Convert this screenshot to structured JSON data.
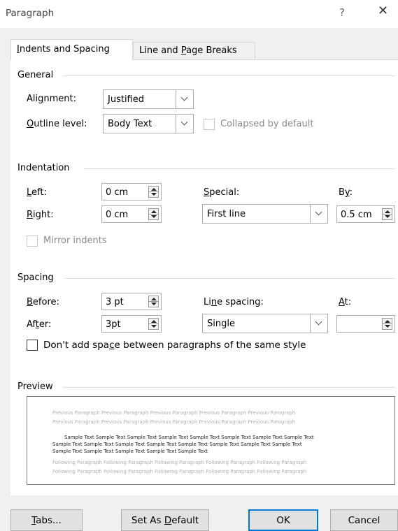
{
  "window": {
    "title": "Paragraph",
    "help": "?",
    "close": "✕"
  },
  "tabs": {
    "indents": {
      "before": "",
      "mnemonic": "I",
      "after": "ndents and Spacing"
    },
    "linebreaks": {
      "before": "Line and ",
      "mnemonic": "P",
      "after": "age Breaks"
    }
  },
  "general": {
    "heading": "General",
    "alignment": {
      "before": "Ali",
      "mnemonic": "g",
      "after": "nment:",
      "value": "Justified"
    },
    "outline": {
      "before": "",
      "mnemonic": "O",
      "after": "utline level:",
      "value": "Body Text"
    },
    "collapsed_label": "Collapsed by default"
  },
  "indentation": {
    "heading": "Indentation",
    "left": {
      "before": "",
      "mnemonic": "L",
      "after": "eft:",
      "value": "0 cm"
    },
    "right": {
      "before": "",
      "mnemonic": "R",
      "after": "ight:",
      "value": "0 cm"
    },
    "special": {
      "before": "",
      "mnemonic": "S",
      "after": "pecial:",
      "value": "First line"
    },
    "by": {
      "before": "B",
      "mnemonic": "y",
      "after": ":",
      "value": "0.5 cm"
    },
    "mirror_label": "Mirror indents"
  },
  "spacing": {
    "heading": "Spacing",
    "before": {
      "before": "",
      "mnemonic": "B",
      "after": "efore:",
      "value": "3 pt"
    },
    "after": {
      "before": "Af",
      "mnemonic": "t",
      "after": "er:",
      "value": "3pt"
    },
    "line_spacing": {
      "before": "Li",
      "mnemonic": "n",
      "after": "e spacing:",
      "value": "Single"
    },
    "at": {
      "before": "",
      "mnemonic": "A",
      "after": "t:",
      "value": ""
    },
    "dont_add": {
      "before": "Don't add spa",
      "mnemonic": "c",
      "after": "e between paragraphs of the same style"
    }
  },
  "preview": {
    "heading": "Preview",
    "lines": [
      "Previous Paragraph Previous Paragraph Previous Paragraph Previous Paragraph Previous Paragraph",
      "Previous Paragraph Previous Paragraph Previous Paragraph Previous Paragraph Previous Paragraph",
      "Sample Text Sample Text Sample Text Sample Text Sample Text Sample Text Sample Text Sample Text",
      "Sample Text Sample Text Sample Text Sample Text Sample Text Sample Text Sample Text Sample Text",
      "Sample Text Sample Text Sample Text Sample Text Sample Text",
      "Following Paragraph Following Paragraph Following Paragraph Following Paragraph Following Paragraph",
      "Following Paragraph Following Paragraph Following Paragraph Following Paragraph Following Paragraph"
    ]
  },
  "buttons": {
    "tabs": {
      "before": "",
      "mnemonic": "T",
      "after": "abs..."
    },
    "default": {
      "before": "Set As ",
      "mnemonic": "D",
      "after": "efault"
    },
    "ok": "OK",
    "cancel": "Cancel"
  },
  "colors": {
    "focus_border": "#0078d7",
    "panel_bg": "#ffffff",
    "dialog_bg": "#f0f0f0"
  }
}
